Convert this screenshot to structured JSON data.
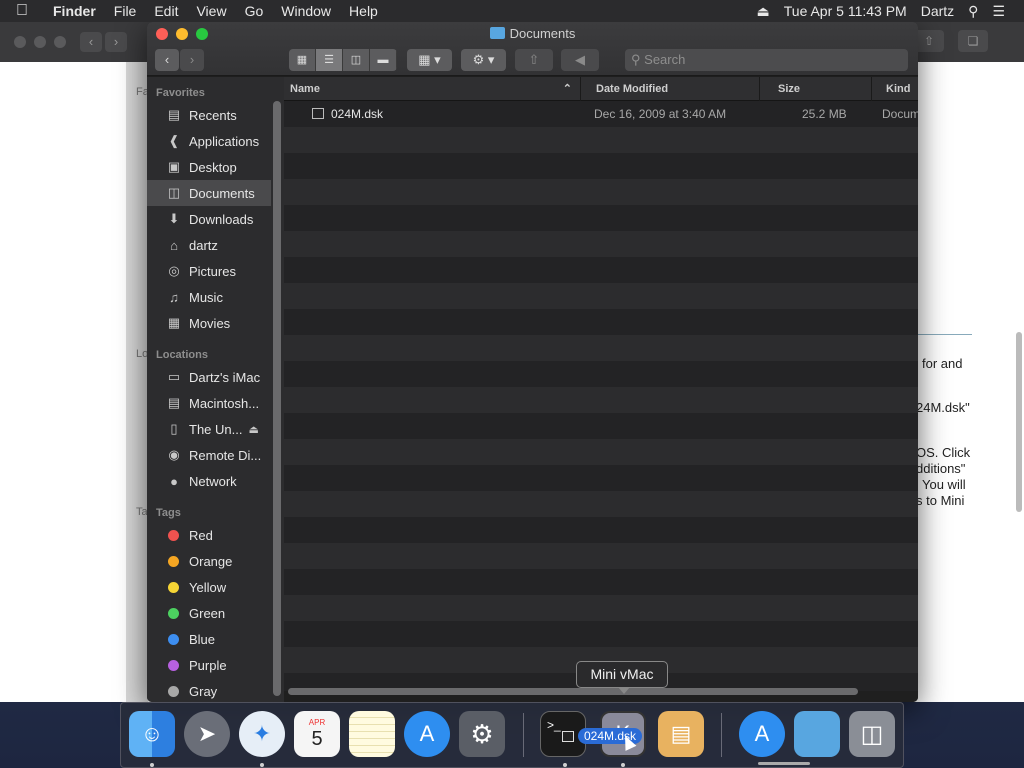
{
  "menubar": {
    "apple_icon": "apple-logo",
    "app_name": "Finder",
    "menus": [
      "File",
      "Edit",
      "View",
      "Go",
      "Window",
      "Help"
    ],
    "status": {
      "eject_icon": "eject-icon",
      "datetime": "Tue Apr 5  11:43 PM",
      "user": "Dartz",
      "search_icon": "spotlight-icon",
      "list_icon": "notification-center-icon"
    }
  },
  "background_window": {
    "sidebar_fragments": [
      "Fa",
      "Lo",
      "Ta"
    ],
    "text_lines": [
      "for  and",
      "24M.dsk\"",
      "OS. Click",
      "dditions\"",
      "You will",
      "s to Mini"
    ]
  },
  "finder": {
    "title": "Documents",
    "toolbar": {
      "back": "‹",
      "forward": "›",
      "view_modes": [
        "icon-view",
        "list-view",
        "column-view",
        "gallery-view"
      ],
      "selected_view": "list-view",
      "group_icon": "group-by-icon",
      "action_icon": "gear-icon",
      "share_icon": "share-icon",
      "tag_icon": "tag-icon",
      "search_placeholder": "Search"
    },
    "sidebar": {
      "favorites_heading": "Favorites",
      "favorites": [
        {
          "label": "Recents",
          "icon": "clock-icon"
        },
        {
          "label": "Applications",
          "icon": "applications-icon"
        },
        {
          "label": "Desktop",
          "icon": "desktop-icon"
        },
        {
          "label": "Documents",
          "icon": "documents-icon",
          "selected": true
        },
        {
          "label": "Downloads",
          "icon": "downloads-icon"
        },
        {
          "label": "dartz",
          "icon": "home-icon"
        },
        {
          "label": "Pictures",
          "icon": "camera-icon"
        },
        {
          "label": "Music",
          "icon": "music-icon"
        },
        {
          "label": "Movies",
          "icon": "film-icon"
        }
      ],
      "locations_heading": "Locations",
      "locations": [
        {
          "label": "Dartz's iMac",
          "icon": "imac-icon"
        },
        {
          "label": "Macintosh...",
          "icon": "disk-icon"
        },
        {
          "label": "The Un...",
          "icon": "external-disk-icon",
          "eject": true
        },
        {
          "label": "Remote Di...",
          "icon": "remote-disc-icon"
        },
        {
          "label": "Network",
          "icon": "globe-icon"
        }
      ],
      "tags_heading": "Tags",
      "tags": [
        {
          "label": "Red",
          "color": "#f0524f"
        },
        {
          "label": "Orange",
          "color": "#f5a623"
        },
        {
          "label": "Yellow",
          "color": "#f6d535"
        },
        {
          "label": "Green",
          "color": "#4cd160"
        },
        {
          "label": "Blue",
          "color": "#3d8ef0"
        },
        {
          "label": "Purple",
          "color": "#b760e0"
        },
        {
          "label": "Gray",
          "color": "#a8a8a8"
        }
      ]
    },
    "columns": {
      "name": "Name",
      "date": "Date Modified",
      "size": "Size",
      "kind": "Kind"
    },
    "files": [
      {
        "name": "024M.dsk",
        "date": "Dec 16, 2009 at 3:40 AM",
        "size": "25.2 MB",
        "kind": "Docume"
      }
    ]
  },
  "dock": {
    "tooltip": "Mini vMac",
    "dragging_label": "024M.dsk",
    "calendar_month": "APR",
    "calendar_day": "5",
    "terminal_prompt": ">_",
    "apps": [
      {
        "name": "finder-icon"
      },
      {
        "name": "launchpad-icon"
      },
      {
        "name": "safari-icon"
      },
      {
        "name": "calendar-icon"
      },
      {
        "name": "notes-icon"
      },
      {
        "name": "app-store-icon"
      },
      {
        "name": "system-preferences-icon"
      },
      {
        "name": "terminal-icon"
      },
      {
        "name": "mini-vmac-icon"
      },
      {
        "name": "archive-utility-icon"
      },
      {
        "name": "app-store-folder-icon"
      },
      {
        "name": "documents-folder-icon"
      },
      {
        "name": "trash-icon"
      }
    ]
  }
}
